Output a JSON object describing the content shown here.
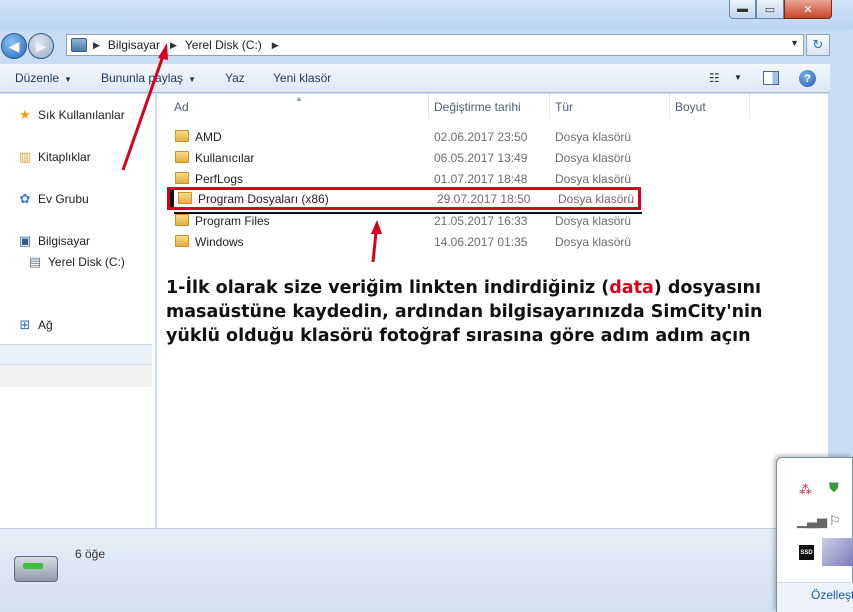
{
  "titlebar": {
    "min": "▬",
    "max": "▭",
    "close": "✕"
  },
  "address": {
    "crumbs": [
      "Bilgisayar",
      "Yerel Disk (C:)"
    ]
  },
  "toolbar": {
    "organize": "Düzenle",
    "share": "Bununla paylaş",
    "burn": "Yaz",
    "new_folder": "Yeni klasör",
    "help": "?"
  },
  "nav": {
    "favorites": "Sık Kullanılanlar",
    "libraries": "Kitaplıklar",
    "homegroup": "Ev Grubu",
    "computer": "Bilgisayar",
    "local_disk": "Yerel Disk (C:)",
    "network": "Ağ"
  },
  "columns": {
    "name": "Ad",
    "date": "Değiştirme tarihi",
    "type": "Tür",
    "size": "Boyut"
  },
  "files": [
    {
      "name": "AMD",
      "date": "02.06.2017 23:50",
      "type": "Dosya klasörü"
    },
    {
      "name": "Kullanıcılar",
      "date": "06.05.2017 13:49",
      "type": "Dosya klasörü"
    },
    {
      "name": "PerfLogs",
      "date": "01.07.2017 18:48",
      "type": "Dosya klasörü"
    },
    {
      "name": "Program Dosyaları (x86)",
      "date": "29.07.2017 18:50",
      "type": "Dosya klasörü"
    },
    {
      "name": "Program Files",
      "date": "21.05.2017 16:33",
      "type": "Dosya klasörü"
    },
    {
      "name": "Windows",
      "date": "14.06.2017 01:35",
      "type": "Dosya klasörü"
    }
  ],
  "note": {
    "before": "1-İlk olarak size veriğim linkten indirdiğiniz (",
    "highlight": "data",
    "after": ") dosyasını masaüstüne kaydedin, ardından bilgisayarınızda SimCity'nin yüklü olduğu klasörü fotoğraf sırasına göre adım adım açın"
  },
  "status": {
    "count": "6 öğe"
  },
  "tray": {
    "ssd_label": "SSD",
    "customize": "Özelleşt"
  },
  "colors": {
    "annotation_red": "#d8001a",
    "accent": "#1a5aa8"
  }
}
